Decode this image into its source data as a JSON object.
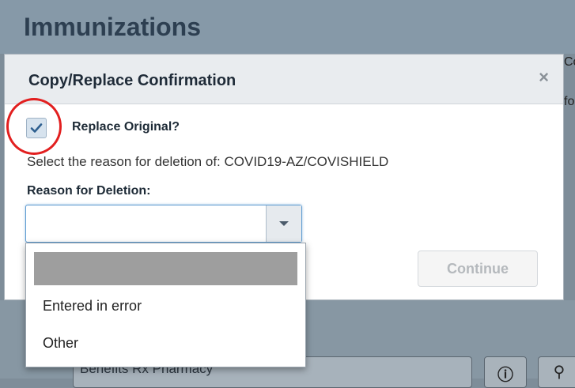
{
  "background": {
    "title": "Immunizations",
    "fragment_top": "Co",
    "fragment_mid": "fo",
    "pharmacy_field": "Benefits Rx Pharmacy"
  },
  "modal": {
    "title": "Copy/Replace Confirmation",
    "close_symbol": "×",
    "replace_checkbox": {
      "label": "Replace Original?",
      "checked": true
    },
    "reason_prompt": "Select the reason for deletion of: COVID19-AZ/COVISHIELD",
    "reason_label": "Reason for Deletion:",
    "reason_select": {
      "value": ""
    },
    "continue_label": "Continue"
  },
  "dropdown": {
    "options": [
      "",
      "Entered in error",
      "Other"
    ]
  },
  "colors": {
    "annotation": "#e21f1f",
    "checkbox_fill": "#d7e3ee",
    "check_mark": "#2e5f8f"
  },
  "icons": {
    "check": "check-icon",
    "dropdown_arrow": "chevron-down-icon",
    "close": "close-icon",
    "info": "info-icon",
    "search": "search-icon"
  }
}
